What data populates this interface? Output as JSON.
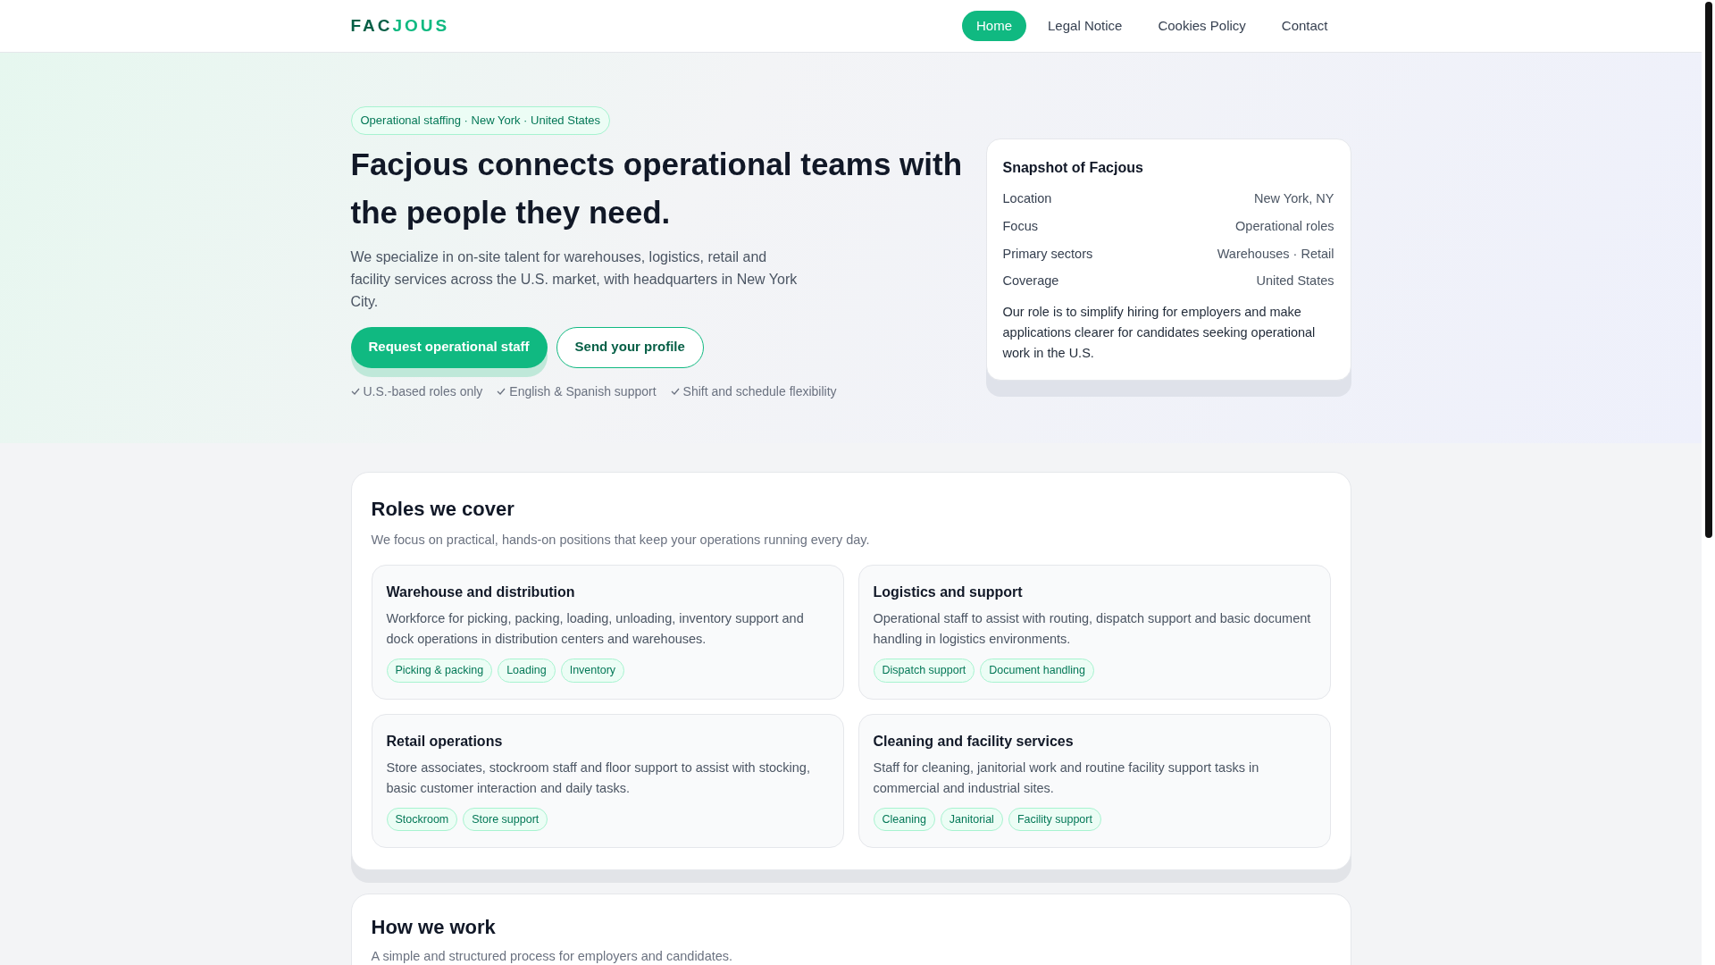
{
  "brand": {
    "first": "FAC",
    "second": "JOUS"
  },
  "nav": [
    {
      "label": "Home",
      "selected": true
    },
    {
      "label": "Legal Notice",
      "selected": false
    },
    {
      "label": "Cookies Policy",
      "selected": false
    },
    {
      "label": "Contact",
      "selected": false
    }
  ],
  "hero": {
    "badge": "Operational staffing · New York · United States",
    "title": "Facjous connects operational teams with the people they need.",
    "text": "We specialize in on-site talent for warehouses, logistics, retail and facility services across the U.S. market, with headquarters in New York City.",
    "buttons": [
      {
        "label": "Request operational staff",
        "kind": "primary"
      },
      {
        "label": "Send your profile",
        "kind": "outline"
      }
    ],
    "checks": [
      "U.S.-based roles only",
      "English & Spanish support",
      "Shift and schedule flexibility"
    ]
  },
  "snapshot": {
    "title": "Snapshot of Facjous",
    "rows": [
      {
        "label": "Location",
        "value": "New York, NY"
      },
      {
        "label": "Focus",
        "value": "Operational roles"
      },
      {
        "label": "Primary sectors",
        "value": "Warehouses · Retail"
      },
      {
        "label": "Coverage",
        "value": "United States"
      }
    ],
    "text": "Our role is to simplify hiring for employers and make applications clearer for candidates seeking operational work in the U.S."
  },
  "roles": {
    "title": "Roles we cover",
    "subtitle": "We focus on practical, hands-on positions that keep your operations running every day.",
    "cards": [
      {
        "title": "Warehouse and distribution",
        "text": "Workforce for picking, packing, loading, unloading, inventory support and dock operations in distribution centers and warehouses.",
        "tags": [
          "Picking & packing",
          "Loading",
          "Inventory"
        ]
      },
      {
        "title": "Logistics and support",
        "text": "Operational staff to assist with routing, dispatch support and basic document handling in logistics environments.",
        "tags": [
          "Dispatch support",
          "Document handling"
        ]
      },
      {
        "title": "Retail operations",
        "text": "Store associates, stockroom staff and floor support to assist with stocking, basic customer interaction and daily tasks.",
        "tags": [
          "Stockroom",
          "Store support"
        ]
      },
      {
        "title": "Cleaning and facility services",
        "text": "Staff for cleaning, janitorial work and routine facility support tasks in commercial and industrial sites.",
        "tags": [
          "Cleaning",
          "Janitorial",
          "Facility support"
        ]
      }
    ]
  },
  "how": {
    "title": "How we work",
    "subtitle": "A simple and structured process for employers and candidates."
  }
}
